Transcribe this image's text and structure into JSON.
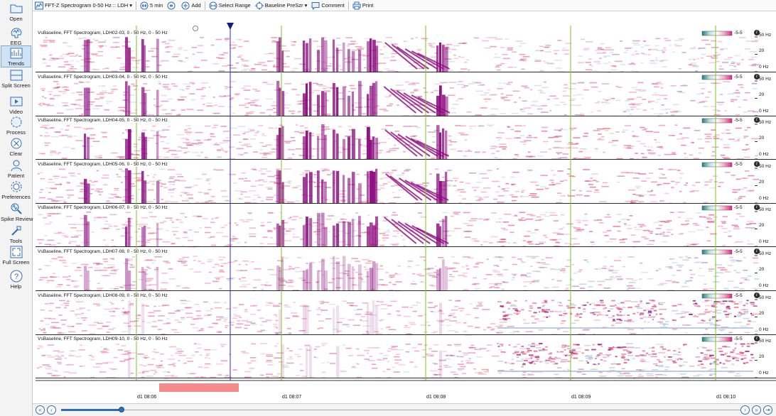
{
  "sidebar": {
    "items": [
      {
        "label": "Open",
        "icon": "folder-icon"
      },
      {
        "label": "EEG",
        "icon": "brain-icon"
      },
      {
        "label": "Trends",
        "icon": "trends-icon",
        "active": true
      },
      {
        "label": "Split Screen",
        "icon": "split-screen-icon"
      },
      {
        "label": "Video",
        "icon": "video-icon"
      },
      {
        "label": "Process",
        "icon": "process-icon"
      },
      {
        "label": "Clear",
        "icon": "clear-icon"
      },
      {
        "label": "Patient",
        "icon": "patient-icon"
      },
      {
        "label": "Preferences",
        "icon": "gear-icon"
      },
      {
        "label": "Spike Review",
        "icon": "spike-review-icon"
      },
      {
        "label": "Tools",
        "icon": "tools-icon"
      },
      {
        "label": "Full Screen",
        "icon": "full-screen-icon"
      },
      {
        "label": "Help",
        "icon": "help-icon"
      }
    ]
  },
  "toolbar": {
    "montage_label": "FFT-Z Spectrogram 0-50 Hz :: LDH",
    "duration_label": "5 min",
    "add_label": "Add",
    "select_range_label": "Select Range",
    "baseline_label": "Baseline PreSzr",
    "comment_label": "Comment",
    "print_label": "Print"
  },
  "channels": [
    {
      "title": "VsBaseline, FFT Spectrogram, LDH02-03, 0 - 50 Hz, 0 - 50 Hz"
    },
    {
      "title": "VsBaseline, FFT Spectrogram, LDH03-04, 0 - 50 Hz, 0 - 50 Hz"
    },
    {
      "title": "VsBaseline, FFT Spectrogram, LDH04-05, 0 - 50 Hz, 0 - 50 Hz"
    },
    {
      "title": "VsBaseline, FFT Spectrogram, LDH05-06, 0 - 50 Hz, 0 - 50 Hz"
    },
    {
      "title": "VsBaseline, FFT Spectrogram, LDH06-07, 0 - 50 Hz, 0 - 50 Hz"
    },
    {
      "title": "VsBaseline, FFT Spectrogram, LDH07-08, 0 - 50 Hz, 0 - 50 Hz"
    },
    {
      "title": "VsBaseline, FFT Spectrogram, LDH08-09, 0 - 50 Hz, 0 - 50 Hz"
    },
    {
      "title": "VsBaseline, FFT Spectrogram, LDH09-10, 0 - 50 Hz, 0 - 50 Hz"
    }
  ],
  "freq_axis": {
    "top": "50 Hz",
    "mid": "20",
    "bottom": "0 Hz"
  },
  "colorbar": {
    "label": "-5-5",
    "colors": [
      "#1f7f7f",
      "#bfe0e0",
      "#ffffff",
      "#f4a6c6",
      "#e0218a"
    ]
  },
  "time_axis": {
    "labels": [
      "d1 08:06",
      "d1 08:07",
      "d1 08:08",
      "d1 08:09",
      "d1 08:10"
    ]
  },
  "colors": {
    "high_power": "#8b0a7e",
    "mid_power": "#e35a7e",
    "low_power": "#9fb6d9",
    "cursor": "#2b2bd0",
    "time_gridline": "#7fbf2a",
    "selection": "#f48a8a"
  },
  "bottom_nav": {
    "first_icon": "double-chevron-left-icon",
    "prev_icon": "chevron-left-icon",
    "next_icon": "chevron-right-icon",
    "last_icon": "double-chevron-right-icon",
    "extra_icon": "end-icon",
    "first_glyph": "«",
    "prev_glyph": "‹",
    "next_glyph": "›",
    "last_glyph": "»",
    "extra_glyph": "⇥"
  }
}
